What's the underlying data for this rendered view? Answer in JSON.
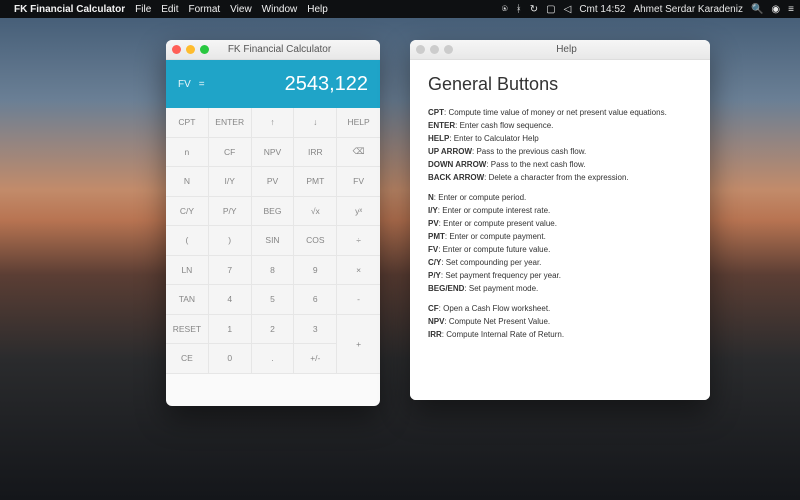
{
  "menubar": {
    "app": "FK Financial Calculator",
    "items": [
      "File",
      "Edit",
      "Format",
      "View",
      "Window",
      "Help"
    ],
    "time": "Cmt 14:52",
    "user": "Ahmet Serdar Karadeniz"
  },
  "calc": {
    "title": "FK Financial Calculator",
    "disp_fn": "FV",
    "disp_eq": "=",
    "disp_val": "2543,122",
    "rows": [
      [
        "CPT",
        "ENTER",
        "↑",
        "↓",
        "HELP"
      ],
      [
        "n",
        "CF",
        "NPV",
        "IRR",
        "⌫"
      ],
      [
        "N",
        "I/Y",
        "PV",
        "PMT",
        "FV"
      ],
      [
        "C/Y",
        "P/Y",
        "BEG",
        "√x",
        "yˣ"
      ],
      [
        "(",
        ")",
        "SIN",
        "COS",
        "÷"
      ],
      [
        "LN",
        "7",
        "8",
        "9",
        "×"
      ],
      [
        "TAN",
        "4",
        "5",
        "6",
        "-"
      ],
      [
        "RESET",
        "1",
        "2",
        "3",
        "+"
      ],
      [
        "CE",
        "0",
        ".",
        "+/-",
        ""
      ]
    ]
  },
  "help": {
    "title": "Help",
    "heading": "General Buttons",
    "g1": [
      {
        "t": "CPT",
        "d": "Compute time value of money or net present value equations."
      },
      {
        "t": "ENTER",
        "d": "Enter cash flow sequence."
      },
      {
        "t": "HELP",
        "d": "Enter to Calculator Help"
      },
      {
        "t": "UP ARROW",
        "d": "Pass to the previous cash flow."
      },
      {
        "t": "DOWN ARROW",
        "d": "Pass to the next cash flow."
      },
      {
        "t": "BACK ARROW",
        "d": "Delete a character from the expression."
      }
    ],
    "g2": [
      {
        "t": "N",
        "d": "Enter or compute period."
      },
      {
        "t": "I/Y",
        "d": "Enter or compute interest rate."
      },
      {
        "t": "PV",
        "d": "Enter or compute present value."
      },
      {
        "t": "PMT",
        "d": "Enter or compute payment."
      },
      {
        "t": "FV",
        "d": "Enter or compute future value."
      },
      {
        "t": "C/Y",
        "d": "Set compounding per year."
      },
      {
        "t": "P/Y",
        "d": "Set payment frequency per year."
      },
      {
        "t": "BEG/END",
        "d": "Set payment mode."
      }
    ],
    "g3": [
      {
        "t": "CF",
        "d": "Open a Cash Flow worksheet."
      },
      {
        "t": "NPV",
        "d": "Compute Net Present Value."
      },
      {
        "t": "IRR",
        "d": "Compute Internal Rate of Return."
      }
    ]
  }
}
